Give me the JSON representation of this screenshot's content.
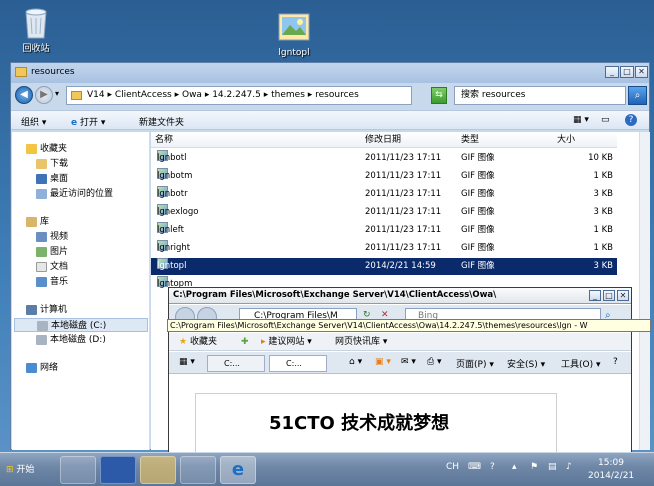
{
  "desktop": {
    "icons": [
      {
        "label": "回收站",
        "icon": "recycle-bin-icon"
      },
      {
        "label": "lgntopl",
        "icon": "image-file-icon"
      }
    ]
  },
  "explorer": {
    "title": "resources",
    "address_crumbs": [
      "V14",
      "ClientAccess",
      "Owa",
      "14.2.247.5",
      "themes",
      "resources"
    ],
    "search_placeholder": "搜索 resources",
    "toolbar": {
      "organize": "组织",
      "open": "打开",
      "new_folder": "新建文件夹"
    },
    "nav": {
      "favorites": "收藏夹",
      "downloads": "下载",
      "desktop": "桌面",
      "recent": "最近访问的位置",
      "library": "库",
      "videos": "视频",
      "pictures": "图片",
      "documents": "文档",
      "music": "音乐",
      "computer": "计算机",
      "local_c": "本地磁盘 (C:)",
      "local_d": "本地磁盘 (D:)",
      "network": "网络"
    },
    "columns": {
      "name": "名称",
      "date": "修改日期",
      "type": "类型",
      "size": "大小"
    },
    "files": [
      {
        "name": "lgnbotl",
        "date": "2011/11/23 17:11",
        "type": "GIF 图像",
        "size": "10 KB"
      },
      {
        "name": "lgnbotm",
        "date": "2011/11/23 17:11",
        "type": "GIF 图像",
        "size": "1 KB"
      },
      {
        "name": "lgnbotr",
        "date": "2011/11/23 17:11",
        "type": "GIF 图像",
        "size": "3 KB"
      },
      {
        "name": "lgnexlogo",
        "date": "2011/11/23 17:11",
        "type": "GIF 图像",
        "size": "3 KB"
      },
      {
        "name": "lgnleft",
        "date": "2011/11/23 17:11",
        "type": "GIF 图像",
        "size": "1 KB"
      },
      {
        "name": "lgnright",
        "date": "2011/11/23 17:11",
        "type": "GIF 图像",
        "size": "1 KB"
      },
      {
        "name": "lgntopl",
        "date": "2014/2/21 14:59",
        "type": "GIF 图像",
        "size": "3 KB"
      },
      {
        "name": "lgntopm",
        "date": "",
        "type": "",
        "size": ""
      }
    ]
  },
  "ie": {
    "title": "C:\\Program Files\\Microsoft\\Exchange Server\\V14\\ClientAccess\\Owa\\",
    "tooltip": "C:\\Program Files\\Microsoft\\Exchange Server\\V14\\ClientAccess\\Owa\\14.2.247.5\\themes\\resources\\lgn - W",
    "address": "C:\\Program Files\\M",
    "search_text": "Bing",
    "favorites_label": "收藏夹",
    "suggested_sites": "建议网站",
    "web_slices": "网页快讯库",
    "tab1": "C:...",
    "tab2": "C:...",
    "page_menu": "页面(P)",
    "safety_menu": "安全(S)",
    "tools_menu": "工具(O)",
    "help_menu": "?",
    "heading": "51CTO 技术成就梦想"
  },
  "taskbar": {
    "start": "开始",
    "lang": "CH",
    "time": "15:09",
    "date": "2014/2/21"
  }
}
